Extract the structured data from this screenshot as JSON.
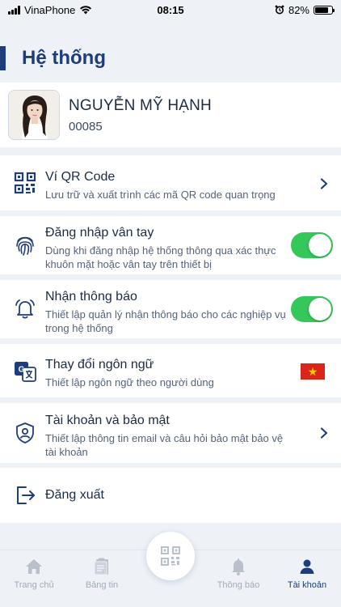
{
  "status_bar": {
    "carrier": "VinaPhone",
    "time": "08:15",
    "battery_text": "82%",
    "battery_level": 0.82
  },
  "page": {
    "title": "Hệ thống"
  },
  "profile": {
    "name": "NGUYỄN MỸ HẠNH",
    "code": "00085"
  },
  "menu": [
    {
      "title": "Ví QR Code",
      "desc": "Lưu trữ và xuất trình các mã QR code quan trọng",
      "icon": "qr-code-icon",
      "control": "chevron"
    },
    {
      "title": "Đăng nhập vân tay",
      "desc": "Dùng khi đăng nhập hệ thống thông qua xác thực khuôn mặt hoặc vân tay trên thiết bị",
      "icon": "fingerprint-icon",
      "control": "toggle",
      "enabled": true
    },
    {
      "title": "Nhận thông báo",
      "desc": "Thiết lập quản lý nhận thông báo cho các nghiệp vụ trong hệ thống",
      "icon": "bell-icon",
      "control": "toggle",
      "enabled": true
    },
    {
      "title": "Thay đổi ngôn ngữ",
      "desc": "Thiết lập ngôn ngữ theo người dùng",
      "icon": "translate-icon",
      "control": "flag-vietnam-icon"
    },
    {
      "title": "Tài khoản và bảo mật",
      "desc": "Thiết lập thông tin email và câu hỏi bảo mật bảo vệ tài khoản",
      "icon": "shield-user-icon",
      "control": "chevron"
    },
    {
      "title": "Đăng xuất",
      "icon": "logout-icon"
    }
  ],
  "tabs": [
    {
      "label": "Trang chủ",
      "icon": "home-icon",
      "active": false
    },
    {
      "label": "Bảng tin",
      "icon": "news-icon",
      "active": false
    },
    {
      "label": "Thông báo",
      "icon": "bell-icon",
      "active": false
    },
    {
      "label": "Tài khoản",
      "icon": "user-icon",
      "active": true
    }
  ],
  "fab": {
    "icon": "qr-scan-icon"
  },
  "colors": {
    "primary": "#1e3d7a",
    "toggle_on": "#34c759",
    "background": "#eef2f7"
  }
}
